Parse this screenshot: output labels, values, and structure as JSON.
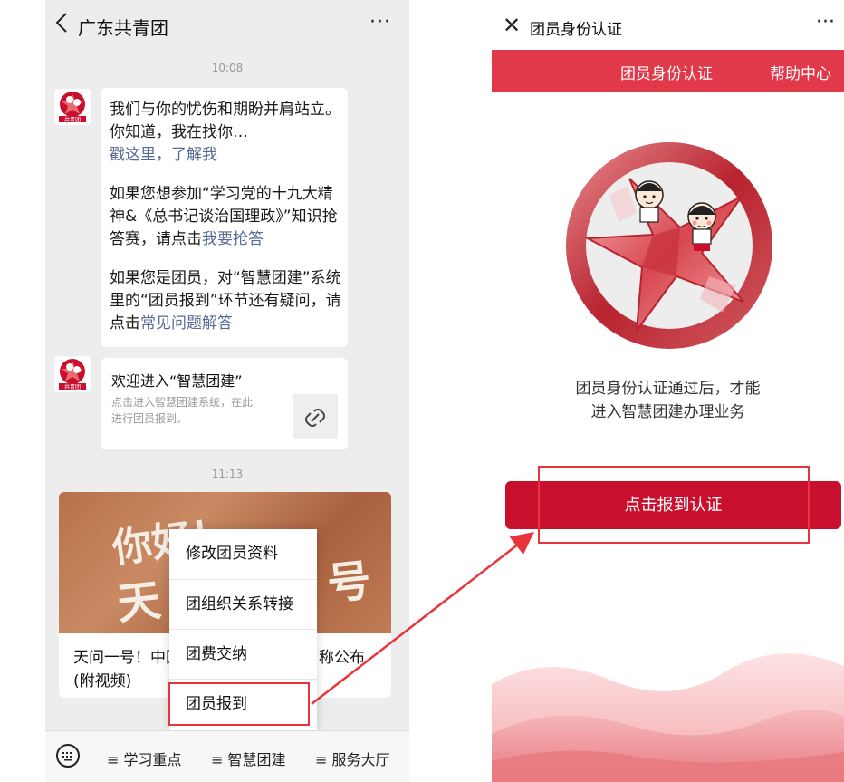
{
  "left_phone": {
    "back_icon": "chevron-left-icon",
    "title": "广东共青团",
    "more_icon": "ellipsis-icon",
    "time_1": "10:08",
    "message_1": {
      "line_1": "我们与你的忧伤和期盼并肩站立。",
      "line_2": "你知道，我在找你…",
      "link_1": "戳这里，了解我",
      "line_3": "如果您想参加“学习党的十九大精",
      "line_4": "神&《总书记谈治国理政》”知识抢",
      "line_5_prefix": "答赛，请点击",
      "link_2": "我要抢答",
      "line_6": "如果您是团员，对“智慧团建”系统",
      "line_7": "里的“团员报到”环节还有疑问，请",
      "line_8_prefix": "点击",
      "link_3": "常见问题解答"
    },
    "link_card": {
      "title": "欢迎进入“智慧团建”",
      "desc_line_1": "点击进入智慧团建系统，在此",
      "desc_line_2": "进行团员报到。",
      "icon": "link-icon"
    },
    "time_2": "11:13",
    "article": {
      "overlay_1": "你好！",
      "overlay_2": "天",
      "overlay_3": "号",
      "title_line_1": "天问一号！中国",
      "title_line_1_end": "称公布",
      "title_line_2": "(附视频)"
    },
    "popup_menu": [
      "修改团员资料",
      "团组织关系转接",
      "团费交纳",
      "团员报到"
    ],
    "bottom_menu": {
      "keyboard_icon": "keyboard-icon",
      "tabs": [
        "≡ 学习重点",
        "≡ 智慧团建",
        "≡ 服务大厅"
      ]
    },
    "avatar_text": "共青团"
  },
  "right_phone": {
    "close_icon": "close-icon",
    "title": "团员身份认证",
    "more_icon": "ellipsis-icon",
    "tabs": [
      "团员身份认证",
      "帮助中心"
    ],
    "desc_line_1": "团员身份认证通过后，才能",
    "desc_line_2": "进入智慧团建办理业务",
    "cta": "点击报到认证"
  },
  "colors": {
    "accent_red": "#e2394a",
    "cta_red": "#c8102e",
    "highlight_box": "#e8343b",
    "link_blue": "#576b95"
  }
}
